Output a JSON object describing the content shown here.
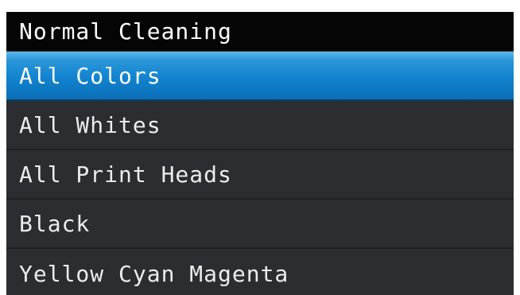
{
  "header": {
    "title": "Normal Cleaning"
  },
  "menu": {
    "selected_index": 0,
    "items": [
      {
        "label": "All Colors"
      },
      {
        "label": "All Whites"
      },
      {
        "label": "All Print Heads"
      },
      {
        "label": "Black"
      },
      {
        "label": "Yellow Cyan Magenta"
      }
    ]
  },
  "colors": {
    "background": "#2b2d30",
    "title_bar": "#050505",
    "selection": "#1283cf",
    "text": "#ececec"
  }
}
